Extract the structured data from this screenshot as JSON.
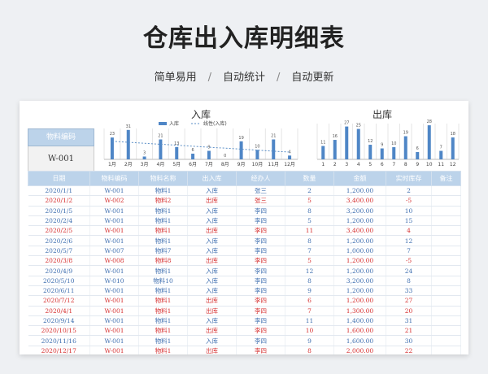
{
  "page_title": "仓库出入库明细表",
  "tags": [
    "简单易用",
    "自动统计",
    "自动更新"
  ],
  "tag_sep": "/",
  "lookup": {
    "label": "物料编码",
    "value": "W-001"
  },
  "charts": [
    {
      "title": "入库",
      "legend": [
        "入库",
        "线性(入库)"
      ],
      "months": [
        "1月",
        "2月",
        "3月",
        "4月",
        "5月",
        "6月",
        "7月",
        "8月",
        "9月",
        "10月",
        "11月",
        "12月"
      ],
      "values": [
        23,
        31,
        3,
        21,
        13,
        6,
        9,
        0,
        19,
        10,
        21,
        4
      ],
      "value_labels": [
        "23",
        "31",
        "3",
        "21",
        "13",
        "6",
        "9",
        "0",
        "19",
        "10",
        "21",
        "4"
      ]
    },
    {
      "title": "出库",
      "months": [
        "1",
        "2",
        "3",
        "4",
        "5",
        "6",
        "7",
        "8",
        "9",
        "10",
        "11",
        "12"
      ],
      "values": [
        11,
        16,
        27,
        25,
        12,
        9,
        10,
        19,
        6,
        28,
        7,
        18
      ],
      "value_labels": [
        "11",
        "16",
        "27",
        "25",
        "12",
        "9",
        "10",
        "19",
        "6",
        "28",
        "7",
        "18"
      ]
    }
  ],
  "table": {
    "headers": [
      "日期",
      "物料编码",
      "物料名称",
      "出入库",
      "经办人",
      "数量",
      "金额",
      "实时库存",
      "备注"
    ],
    "rows": [
      {
        "type": "in",
        "cells": [
          "2020/1/1",
          "W-001",
          "物料1",
          "入库",
          "张三",
          "2",
          "1,200.00",
          "2",
          ""
        ]
      },
      {
        "type": "out",
        "cells": [
          "2020/1/2",
          "W-002",
          "物料2",
          "出库",
          "张三",
          "5",
          "3,400.00",
          "-5",
          ""
        ]
      },
      {
        "type": "in",
        "cells": [
          "2020/1/5",
          "W-001",
          "物料1",
          "入库",
          "李四",
          "8",
          "3,200.00",
          "10",
          ""
        ]
      },
      {
        "type": "in",
        "cells": [
          "2020/2/4",
          "W-001",
          "物料1",
          "入库",
          "李四",
          "5",
          "1,200.00",
          "15",
          ""
        ]
      },
      {
        "type": "out",
        "cells": [
          "2020/2/5",
          "W-001",
          "物料1",
          "出库",
          "李四",
          "11",
          "3,400.00",
          "4",
          ""
        ]
      },
      {
        "type": "in",
        "cells": [
          "2020/2/6",
          "W-001",
          "物料1",
          "入库",
          "李四",
          "8",
          "1,200.00",
          "12",
          ""
        ]
      },
      {
        "type": "in",
        "cells": [
          "2020/5/7",
          "W-007",
          "物料7",
          "入库",
          "李四",
          "7",
          "1,000.00",
          "7",
          ""
        ]
      },
      {
        "type": "out",
        "cells": [
          "2020/3/8",
          "W-008",
          "物料8",
          "出库",
          "李四",
          "5",
          "1,200.00",
          "-5",
          ""
        ]
      },
      {
        "type": "in",
        "cells": [
          "2020/4/9",
          "W-001",
          "物料1",
          "入库",
          "李四",
          "12",
          "1,200.00",
          "24",
          ""
        ]
      },
      {
        "type": "in",
        "cells": [
          "2020/5/10",
          "W-010",
          "物料10",
          "入库",
          "李四",
          "8",
          "3,200.00",
          "8",
          ""
        ]
      },
      {
        "type": "in",
        "cells": [
          "2020/6/11",
          "W-001",
          "物料1",
          "入库",
          "李四",
          "9",
          "1,200.00",
          "33",
          ""
        ]
      },
      {
        "type": "out",
        "cells": [
          "2020/7/12",
          "W-001",
          "物料1",
          "出库",
          "李四",
          "6",
          "1,200.00",
          "27",
          ""
        ]
      },
      {
        "type": "out",
        "cells": [
          "2020/4/1",
          "W-001",
          "物料1",
          "出库",
          "李四",
          "7",
          "1,300.00",
          "20",
          ""
        ]
      },
      {
        "type": "in",
        "cells": [
          "2020/9/14",
          "W-001",
          "物料1",
          "入库",
          "李四",
          "11",
          "1,400.00",
          "31",
          ""
        ]
      },
      {
        "type": "out",
        "cells": [
          "2020/10/15",
          "W-001",
          "物料1",
          "出库",
          "李四",
          "10",
          "1,600.00",
          "21",
          ""
        ]
      },
      {
        "type": "in",
        "cells": [
          "2020/11/16",
          "W-001",
          "物料1",
          "入库",
          "李四",
          "9",
          "1,600.00",
          "30",
          ""
        ]
      },
      {
        "type": "out",
        "cells": [
          "2020/12/17",
          "W-001",
          "物料1",
          "出库",
          "李四",
          "8",
          "2,000.00",
          "22",
          ""
        ]
      }
    ]
  },
  "colors": {
    "header_bg": "#bcd3ea",
    "in_text": "#3f6fb0",
    "out_text": "#d63030",
    "bar": "#4f86c6"
  },
  "chart_data": [
    {
      "type": "bar",
      "title": "入库",
      "categories": [
        "1月",
        "2月",
        "3月",
        "4月",
        "5月",
        "6月",
        "7月",
        "8月",
        "9月",
        "10月",
        "11月",
        "12月"
      ],
      "series": [
        {
          "name": "入库",
          "values": [
            23,
            31,
            3,
            21,
            13,
            6,
            9,
            0,
            19,
            10,
            21,
            4
          ]
        }
      ],
      "trendline": "线性(入库)"
    },
    {
      "type": "bar",
      "title": "出库",
      "categories": [
        "1",
        "2",
        "3",
        "4",
        "5",
        "6",
        "7",
        "8",
        "9",
        "10",
        "11",
        "12"
      ],
      "series": [
        {
          "values": [
            11,
            16,
            27,
            25,
            12,
            9,
            10,
            19,
            6,
            28,
            7,
            18
          ]
        }
      ]
    }
  ]
}
